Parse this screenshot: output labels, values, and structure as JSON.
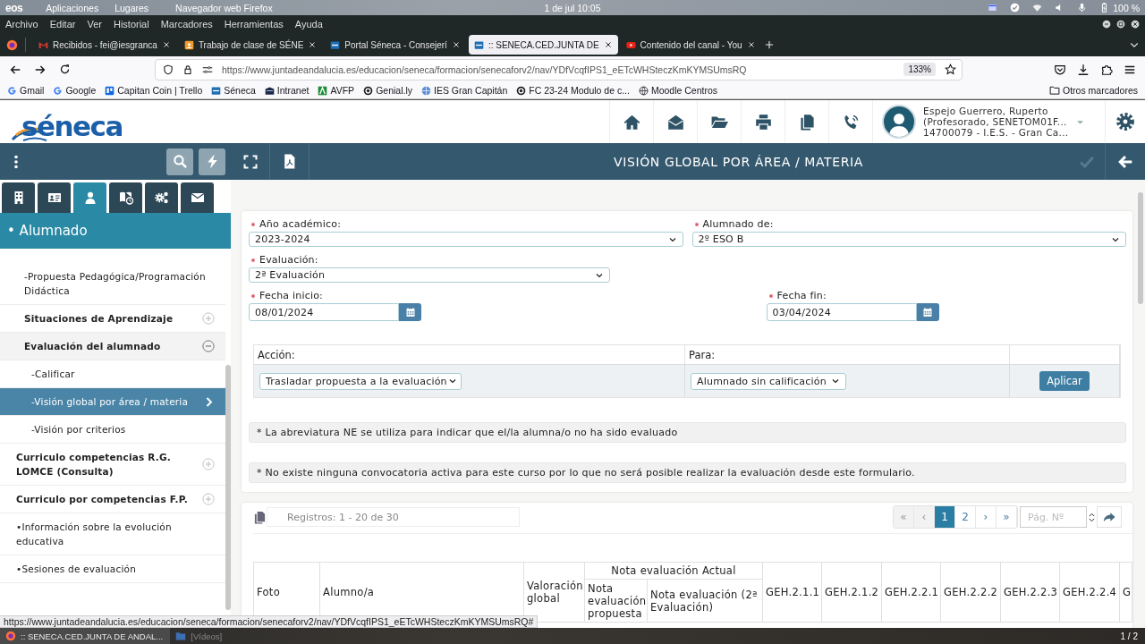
{
  "system_bar": {
    "logo": "eos",
    "menus": [
      "Aplicaciones",
      "Lugares"
    ],
    "active_app": "Navegador web Firefox",
    "clock": "1 de jul 10:05",
    "battery": "100 %"
  },
  "menu_bar": [
    "Archivo",
    "Editar",
    "Ver",
    "Historial",
    "Marcadores",
    "Herramientas",
    "Ayuda"
  ],
  "tabs": [
    {
      "label": "Recibidos - fei@iesgranca",
      "selected": false
    },
    {
      "label": "Trabajo de clase de SÉNE",
      "selected": false
    },
    {
      "label": "Portal Séneca - Consejerí",
      "selected": false
    },
    {
      "label": ":: SENECA.CED.JUNTA DE",
      "selected": true
    },
    {
      "label": "Contenido del canal - You",
      "selected": false
    }
  ],
  "address_bar": {
    "url": "https://www.juntadeandalucia.es/educacion/seneca/formacion/senecaforv2/nav/YDfVcqfIPS1_eETcWHSteczKmKYMSUmsRQ",
    "zoom": "133%"
  },
  "bookmarks": [
    "Gmail",
    "Google",
    "Capitan Coin | Trello",
    "Séneca",
    "Intranet",
    "AVFP",
    "Genial.ly",
    "IES Gran Capitán",
    "FC 23-24 Modulo de c...",
    "Moodle Centros"
  ],
  "other_bookmarks": "Otros marcadores",
  "header": {
    "logo": "séneca",
    "user": [
      "Espejo Guerrero, Ruperto",
      "(Profesorado, SENETOM01F...",
      "14700079 - I.E.S. - Gran Ca..."
    ]
  },
  "sidebar": {
    "tabs": [
      {
        "selected": false
      },
      {
        "selected": false
      },
      {
        "selected": true
      },
      {
        "selected": false
      },
      {
        "selected": false
      },
      {
        "selected": false
      }
    ],
    "section": "• Alumnado",
    "items": [
      {
        "kind": "page",
        "label": "-Propuesta Pedagógica/Programación Didáctica",
        "selected": false
      },
      {
        "kind": "group",
        "label": "Situaciones de Aprendizaje",
        "expanded": false
      },
      {
        "kind": "group",
        "label": "Evaluación del alumnado",
        "expanded": true,
        "children": [
          {
            "kind": "page",
            "label": "-Calificar",
            "selected": false
          },
          {
            "kind": "page",
            "label": "-Visión global por área / materia",
            "selected": true
          },
          {
            "kind": "page",
            "label": "-Visión por criterios",
            "selected": false
          }
        ]
      },
      {
        "kind": "section",
        "label": "Curriculo competencias R.G. LOMCE (Consulta)",
        "expanded": false
      },
      {
        "kind": "section",
        "label": "Curriculo por competencias F.P.",
        "expanded": false
      },
      {
        "kind": "entry",
        "label": "•Información sobre la evolución educativa",
        "selected": false
      },
      {
        "kind": "entry",
        "label": "•Sesiones de evaluación",
        "selected": false
      }
    ]
  },
  "page": {
    "title": "VISIÓN GLOBAL POR ÁREA / MATERIA",
    "confirm": {
      "disabled": true
    },
    "form_rows": [
      [
        {
          "kind": "select",
          "label": "Año académico:",
          "value": "2023-2024",
          "required": true
        },
        {
          "kind": "select",
          "label": "Alumnado de:",
          "value": "2º ESO B",
          "required": true
        }
      ],
      [
        {
          "kind": "select",
          "label": "Evaluación:",
          "value": "2ª Evaluación",
          "required": true
        }
      ],
      [
        {
          "kind": "date",
          "label": "Fecha inicio:",
          "value": "08/01/2024",
          "required": true
        },
        {
          "kind": "date",
          "label": "Fecha fin:",
          "value": "03/04/2024",
          "required": true
        }
      ]
    ],
    "action_table": {
      "columns": [
        "Acción:",
        "Para:"
      ],
      "controls": [
        {
          "kind": "select",
          "value": "Trasladar propuesta a la evaluación"
        },
        {
          "kind": "select",
          "value": "Alumnado sin calificación"
        },
        {
          "kind": "button",
          "label": "Aplicar"
        }
      ]
    },
    "notes": [
      "* La abreviatura NE se utiliza para indicar que el/la alumna/o no ha sido evaluado",
      "* No existe ninguna convocatoria activa para este curso por lo que no será posible realizar la evaluación desde este formulario."
    ],
    "records": "Registros: 1 - 20 de 30",
    "pager": [
      {
        "label": "«",
        "selected": false,
        "disabled": true
      },
      {
        "label": "‹",
        "selected": false,
        "disabled": true
      },
      {
        "label": "1",
        "selected": true,
        "disabled": false
      },
      {
        "label": "2",
        "selected": false,
        "disabled": false
      },
      {
        "label": "›",
        "selected": false,
        "disabled": false
      },
      {
        "label": "»",
        "selected": false,
        "disabled": false
      }
    ],
    "page_input": {
      "placeholder": "Pág. Nº"
    },
    "table": {
      "columns": [
        {
          "label": "Foto"
        },
        {
          "label": "Alumno/a"
        },
        {
          "label": "Valoración global"
        },
        {
          "label": "Nota evaluación Actual",
          "children": [
            {
              "label": "Nota evaluación propuesta"
            },
            {
              "label": "Nota evaluación (2ª Evaluación)"
            }
          ]
        },
        {
          "label": "GEH.2.1.1"
        },
        {
          "label": "GEH.2.1.2"
        },
        {
          "label": "GEH.2.2.1"
        },
        {
          "label": "GEH.2.2.2"
        },
        {
          "label": "GEH.2.2.3"
        },
        {
          "label": "GEH.2.2.4"
        },
        {
          "label": "G"
        }
      ]
    }
  },
  "status_link": "https://www.juntadeandalucia.es/educacion/seneca/formacion/senecaforv2/nav/YDfVcqfIPS1_eETcWHSteczKmKYMSUmsRQ#",
  "taskbar": {
    "windows": [
      {
        "label": ":: SENECA.CED.JUNTA DE ANDAL...",
        "selected": true
      },
      {
        "label": "[Vídeos]",
        "selected": false
      }
    ],
    "workspace": "1 / 2"
  }
}
